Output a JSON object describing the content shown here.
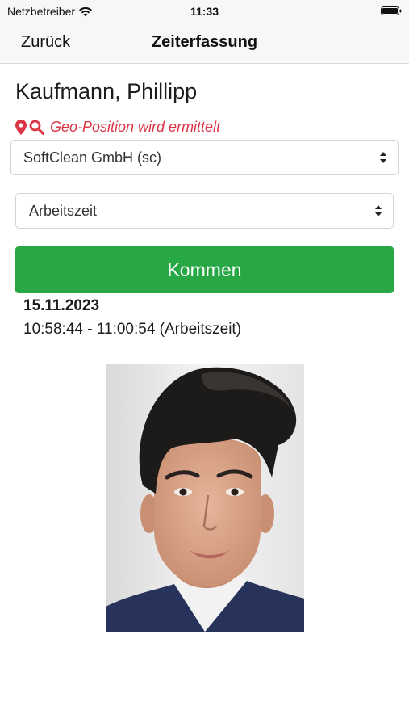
{
  "status_bar": {
    "carrier": "Netzbetreiber",
    "time": "11:33",
    "icons": [
      "wifi-icon",
      "battery-icon"
    ]
  },
  "nav": {
    "back_label": "Zurück",
    "title": "Zeiterfassung"
  },
  "employee": {
    "name": "Kaufmann, Phillipp"
  },
  "geo": {
    "status_text": "Geo-Position wird ermittelt",
    "icons": [
      "map-marker-icon",
      "search-icon"
    ],
    "color": "#dc3545"
  },
  "company_select": {
    "selected": "SoftClean GmbH (sc)"
  },
  "type_select": {
    "selected": "Arbeitszeit"
  },
  "action": {
    "kommen_label": "Kommen",
    "color": "#28a745"
  },
  "entries": {
    "date": "15.11.2023",
    "items": [
      "10:58:44 - 11:00:54 (Arbeitszeit)"
    ]
  },
  "photo": {
    "subject": "employee-portrait"
  }
}
